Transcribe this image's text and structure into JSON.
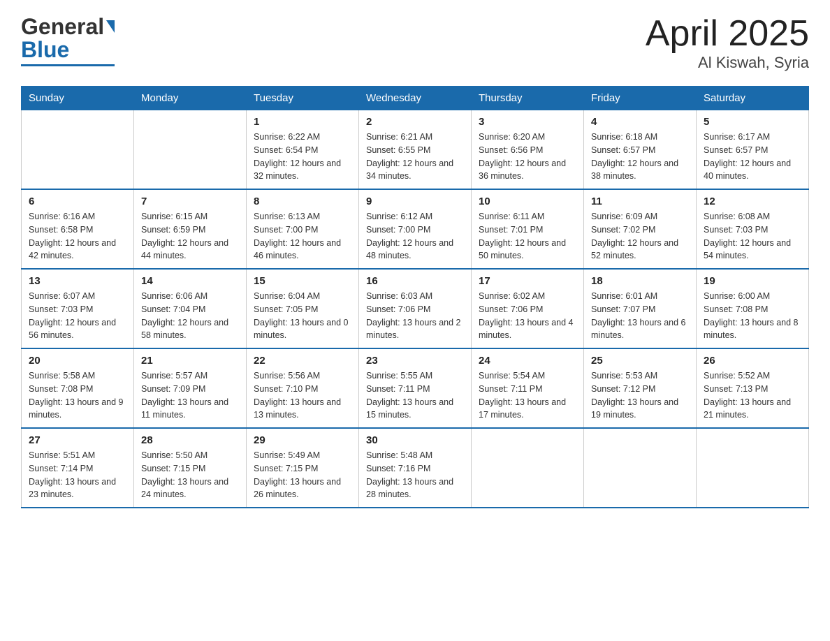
{
  "header": {
    "logo_general": "General",
    "logo_blue": "Blue",
    "title": "April 2025",
    "subtitle": "Al Kiswah, Syria"
  },
  "weekdays": [
    "Sunday",
    "Monday",
    "Tuesday",
    "Wednesday",
    "Thursday",
    "Friday",
    "Saturday"
  ],
  "weeks": [
    [
      {
        "day": "",
        "sunrise": "",
        "sunset": "",
        "daylight": ""
      },
      {
        "day": "",
        "sunrise": "",
        "sunset": "",
        "daylight": ""
      },
      {
        "day": "1",
        "sunrise": "Sunrise: 6:22 AM",
        "sunset": "Sunset: 6:54 PM",
        "daylight": "Daylight: 12 hours and 32 minutes."
      },
      {
        "day": "2",
        "sunrise": "Sunrise: 6:21 AM",
        "sunset": "Sunset: 6:55 PM",
        "daylight": "Daylight: 12 hours and 34 minutes."
      },
      {
        "day": "3",
        "sunrise": "Sunrise: 6:20 AM",
        "sunset": "Sunset: 6:56 PM",
        "daylight": "Daylight: 12 hours and 36 minutes."
      },
      {
        "day": "4",
        "sunrise": "Sunrise: 6:18 AM",
        "sunset": "Sunset: 6:57 PM",
        "daylight": "Daylight: 12 hours and 38 minutes."
      },
      {
        "day": "5",
        "sunrise": "Sunrise: 6:17 AM",
        "sunset": "Sunset: 6:57 PM",
        "daylight": "Daylight: 12 hours and 40 minutes."
      }
    ],
    [
      {
        "day": "6",
        "sunrise": "Sunrise: 6:16 AM",
        "sunset": "Sunset: 6:58 PM",
        "daylight": "Daylight: 12 hours and 42 minutes."
      },
      {
        "day": "7",
        "sunrise": "Sunrise: 6:15 AM",
        "sunset": "Sunset: 6:59 PM",
        "daylight": "Daylight: 12 hours and 44 minutes."
      },
      {
        "day": "8",
        "sunrise": "Sunrise: 6:13 AM",
        "sunset": "Sunset: 7:00 PM",
        "daylight": "Daylight: 12 hours and 46 minutes."
      },
      {
        "day": "9",
        "sunrise": "Sunrise: 6:12 AM",
        "sunset": "Sunset: 7:00 PM",
        "daylight": "Daylight: 12 hours and 48 minutes."
      },
      {
        "day": "10",
        "sunrise": "Sunrise: 6:11 AM",
        "sunset": "Sunset: 7:01 PM",
        "daylight": "Daylight: 12 hours and 50 minutes."
      },
      {
        "day": "11",
        "sunrise": "Sunrise: 6:09 AM",
        "sunset": "Sunset: 7:02 PM",
        "daylight": "Daylight: 12 hours and 52 minutes."
      },
      {
        "day": "12",
        "sunrise": "Sunrise: 6:08 AM",
        "sunset": "Sunset: 7:03 PM",
        "daylight": "Daylight: 12 hours and 54 minutes."
      }
    ],
    [
      {
        "day": "13",
        "sunrise": "Sunrise: 6:07 AM",
        "sunset": "Sunset: 7:03 PM",
        "daylight": "Daylight: 12 hours and 56 minutes."
      },
      {
        "day": "14",
        "sunrise": "Sunrise: 6:06 AM",
        "sunset": "Sunset: 7:04 PM",
        "daylight": "Daylight: 12 hours and 58 minutes."
      },
      {
        "day": "15",
        "sunrise": "Sunrise: 6:04 AM",
        "sunset": "Sunset: 7:05 PM",
        "daylight": "Daylight: 13 hours and 0 minutes."
      },
      {
        "day": "16",
        "sunrise": "Sunrise: 6:03 AM",
        "sunset": "Sunset: 7:06 PM",
        "daylight": "Daylight: 13 hours and 2 minutes."
      },
      {
        "day": "17",
        "sunrise": "Sunrise: 6:02 AM",
        "sunset": "Sunset: 7:06 PM",
        "daylight": "Daylight: 13 hours and 4 minutes."
      },
      {
        "day": "18",
        "sunrise": "Sunrise: 6:01 AM",
        "sunset": "Sunset: 7:07 PM",
        "daylight": "Daylight: 13 hours and 6 minutes."
      },
      {
        "day": "19",
        "sunrise": "Sunrise: 6:00 AM",
        "sunset": "Sunset: 7:08 PM",
        "daylight": "Daylight: 13 hours and 8 minutes."
      }
    ],
    [
      {
        "day": "20",
        "sunrise": "Sunrise: 5:58 AM",
        "sunset": "Sunset: 7:08 PM",
        "daylight": "Daylight: 13 hours and 9 minutes."
      },
      {
        "day": "21",
        "sunrise": "Sunrise: 5:57 AM",
        "sunset": "Sunset: 7:09 PM",
        "daylight": "Daylight: 13 hours and 11 minutes."
      },
      {
        "day": "22",
        "sunrise": "Sunrise: 5:56 AM",
        "sunset": "Sunset: 7:10 PM",
        "daylight": "Daylight: 13 hours and 13 minutes."
      },
      {
        "day": "23",
        "sunrise": "Sunrise: 5:55 AM",
        "sunset": "Sunset: 7:11 PM",
        "daylight": "Daylight: 13 hours and 15 minutes."
      },
      {
        "day": "24",
        "sunrise": "Sunrise: 5:54 AM",
        "sunset": "Sunset: 7:11 PM",
        "daylight": "Daylight: 13 hours and 17 minutes."
      },
      {
        "day": "25",
        "sunrise": "Sunrise: 5:53 AM",
        "sunset": "Sunset: 7:12 PM",
        "daylight": "Daylight: 13 hours and 19 minutes."
      },
      {
        "day": "26",
        "sunrise": "Sunrise: 5:52 AM",
        "sunset": "Sunset: 7:13 PM",
        "daylight": "Daylight: 13 hours and 21 minutes."
      }
    ],
    [
      {
        "day": "27",
        "sunrise": "Sunrise: 5:51 AM",
        "sunset": "Sunset: 7:14 PM",
        "daylight": "Daylight: 13 hours and 23 minutes."
      },
      {
        "day": "28",
        "sunrise": "Sunrise: 5:50 AM",
        "sunset": "Sunset: 7:15 PM",
        "daylight": "Daylight: 13 hours and 24 minutes."
      },
      {
        "day": "29",
        "sunrise": "Sunrise: 5:49 AM",
        "sunset": "Sunset: 7:15 PM",
        "daylight": "Daylight: 13 hours and 26 minutes."
      },
      {
        "day": "30",
        "sunrise": "Sunrise: 5:48 AM",
        "sunset": "Sunset: 7:16 PM",
        "daylight": "Daylight: 13 hours and 28 minutes."
      },
      {
        "day": "",
        "sunrise": "",
        "sunset": "",
        "daylight": ""
      },
      {
        "day": "",
        "sunrise": "",
        "sunset": "",
        "daylight": ""
      },
      {
        "day": "",
        "sunrise": "",
        "sunset": "",
        "daylight": ""
      }
    ]
  ]
}
